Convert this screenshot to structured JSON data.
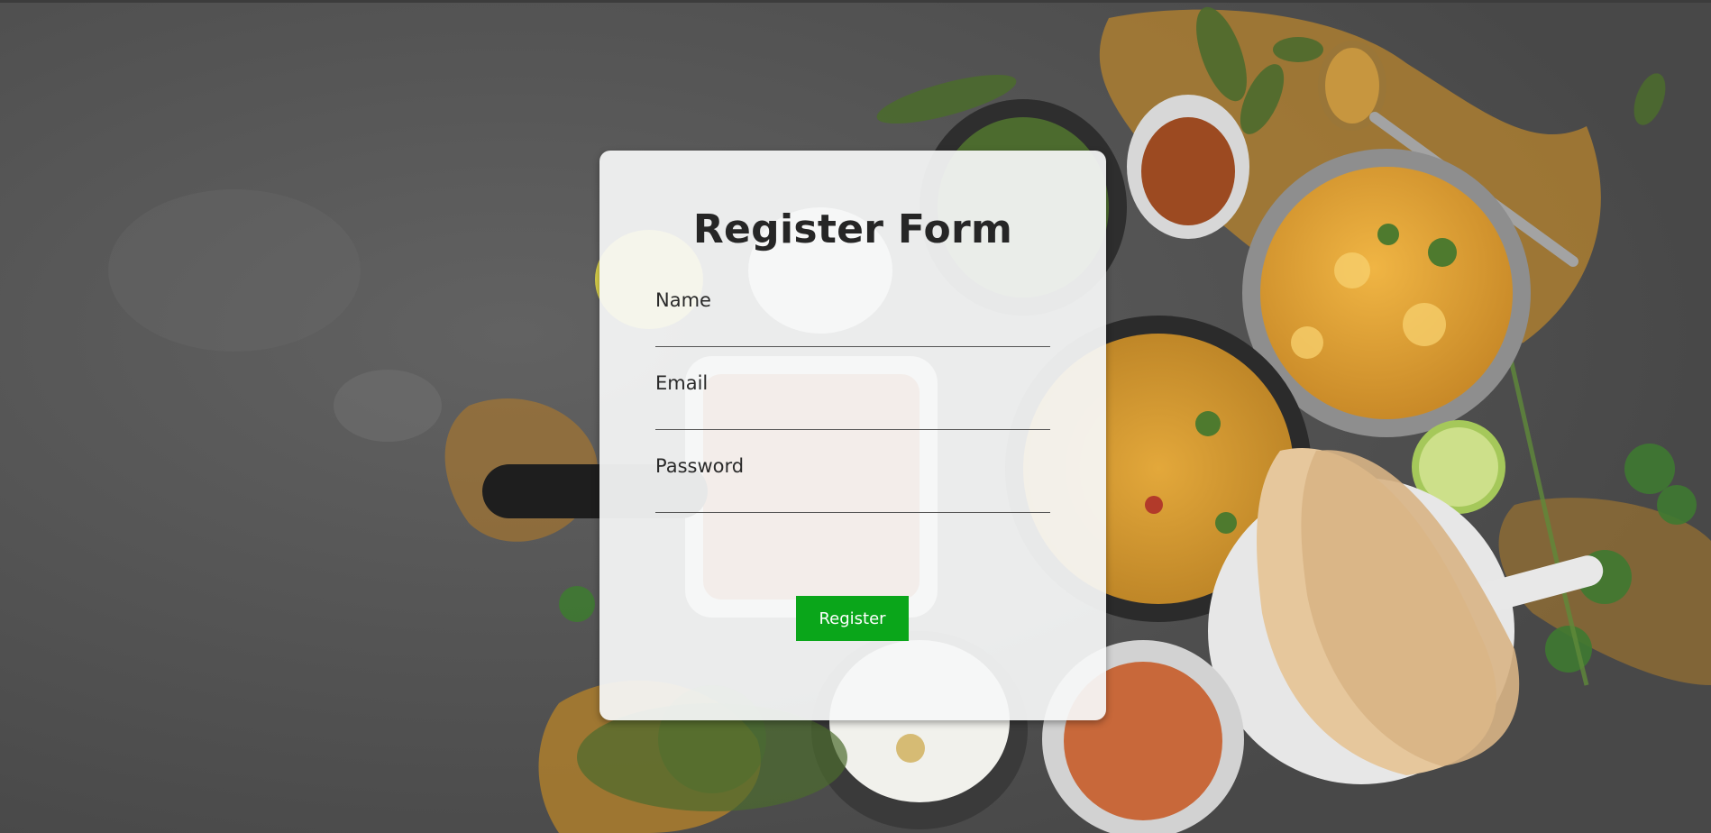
{
  "form": {
    "title": "Register Form",
    "fields": [
      {
        "label": "Name",
        "value": "",
        "type": "text"
      },
      {
        "label": "Email",
        "value": "",
        "type": "email"
      },
      {
        "label": "Password",
        "value": "",
        "type": "password"
      }
    ],
    "submit_label": "Register"
  },
  "colors": {
    "button": "#0aa61a",
    "card": "#f6f7f8",
    "background": "#5a5a5a"
  }
}
